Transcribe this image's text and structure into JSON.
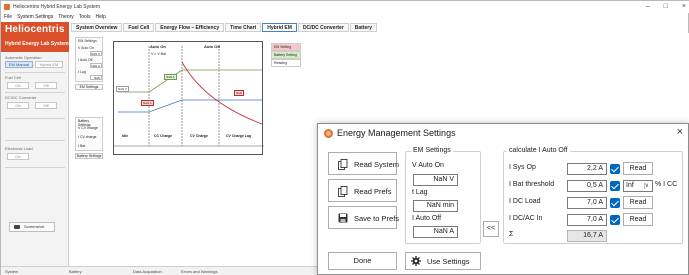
{
  "app": {
    "window_title": "Heliocentris Hybrid Energy Lab System",
    "menu": [
      "File",
      "System Settings",
      "Theory",
      "Tools",
      "Help"
    ],
    "tabs": [
      "System Overview",
      "Fuel Cell",
      "Energy Flow – Efficiency",
      "Time Chart",
      "Hybrid EM",
      "DC/DC Converter",
      "Battery"
    ],
    "active_tab": "Hybrid EM",
    "brand": {
      "name": "Heliocentris",
      "tagline": "Hybrid Energy Lab System"
    },
    "sidebar": {
      "automatic_operation": "Automatic Operation",
      "mode_buttons": [
        "EM Manual",
        "Hybrid EM"
      ],
      "fuel_cell": "Fuel Cell",
      "dc_converter": "DC/DC Converter",
      "on_off": [
        "On",
        "Off"
      ],
      "electronic_load": "Electronic Load",
      "screenshot": "Screenshot"
    },
    "em_settings": {
      "group": "EM Settings",
      "fields": [
        "V Auto On",
        "I Auto Off",
        "t Lag"
      ],
      "values": [
        "NaN V",
        "NaN A",
        "NaN"
      ],
      "button": "EM Settings"
    },
    "battery_settings": {
      "group": "Battery Settings",
      "fields": [
        "V CV charge",
        "I CV charge",
        "t Bat"
      ],
      "button": "Battery Settings"
    },
    "diagram": {
      "top_labels": [
        "Auto On",
        "Auto Off"
      ],
      "bottom_labels": [
        "Idle",
        "CC Charge",
        "CV Charge",
        "CV Charge Lag"
      ],
      "axis": "V > V Bat",
      "boxes": [
        "NaN V",
        "NaN A",
        "NaN",
        "NaN A"
      ]
    },
    "side_list": [
      "EM Setting",
      "Battery Setting",
      "Reading"
    ],
    "status": {
      "left": "System",
      "mid": "Battery",
      "acq": "Data Acquisition",
      "errors": "Errors and Warnings"
    }
  },
  "dialog": {
    "title": "Energy Management Settings",
    "buttons": {
      "read_system": "Read System",
      "read_prefs": "Read Prefs",
      "save_prefs": "Save to Prefs",
      "done": "Done",
      "use_settings": "Use Settings",
      "copy_left": "<<"
    },
    "em_settings": {
      "legend": "EM Settings",
      "v_auto_on_label": "V Auto On",
      "v_auto_on_value": "NaN V",
      "t_lag_label": "t Lag",
      "t_lag_value": "NaN min",
      "i_auto_off_label": "I Auto Off",
      "i_auto_off_value": "NaN A"
    },
    "calc": {
      "legend": "calculate I Auto Off",
      "read_label": "Read",
      "rows": [
        {
          "label": "I Sys Op",
          "value": "2,2 A",
          "checked": true
        },
        {
          "label": "I Bat threshold",
          "value": "0,5 A",
          "checked": true
        },
        {
          "label": "I DC Load",
          "value": "7,0 A",
          "checked": true
        },
        {
          "label": "I DC/AC In",
          "value": "7,0 A",
          "checked": true
        }
      ],
      "sum_label": "Σ",
      "sum_value": "16,7 A",
      "threshold_option": "Inf",
      "threshold_unit": "% I CC"
    },
    "colors": {
      "accent": "#0067c0",
      "brand": "#d9502a"
    }
  }
}
